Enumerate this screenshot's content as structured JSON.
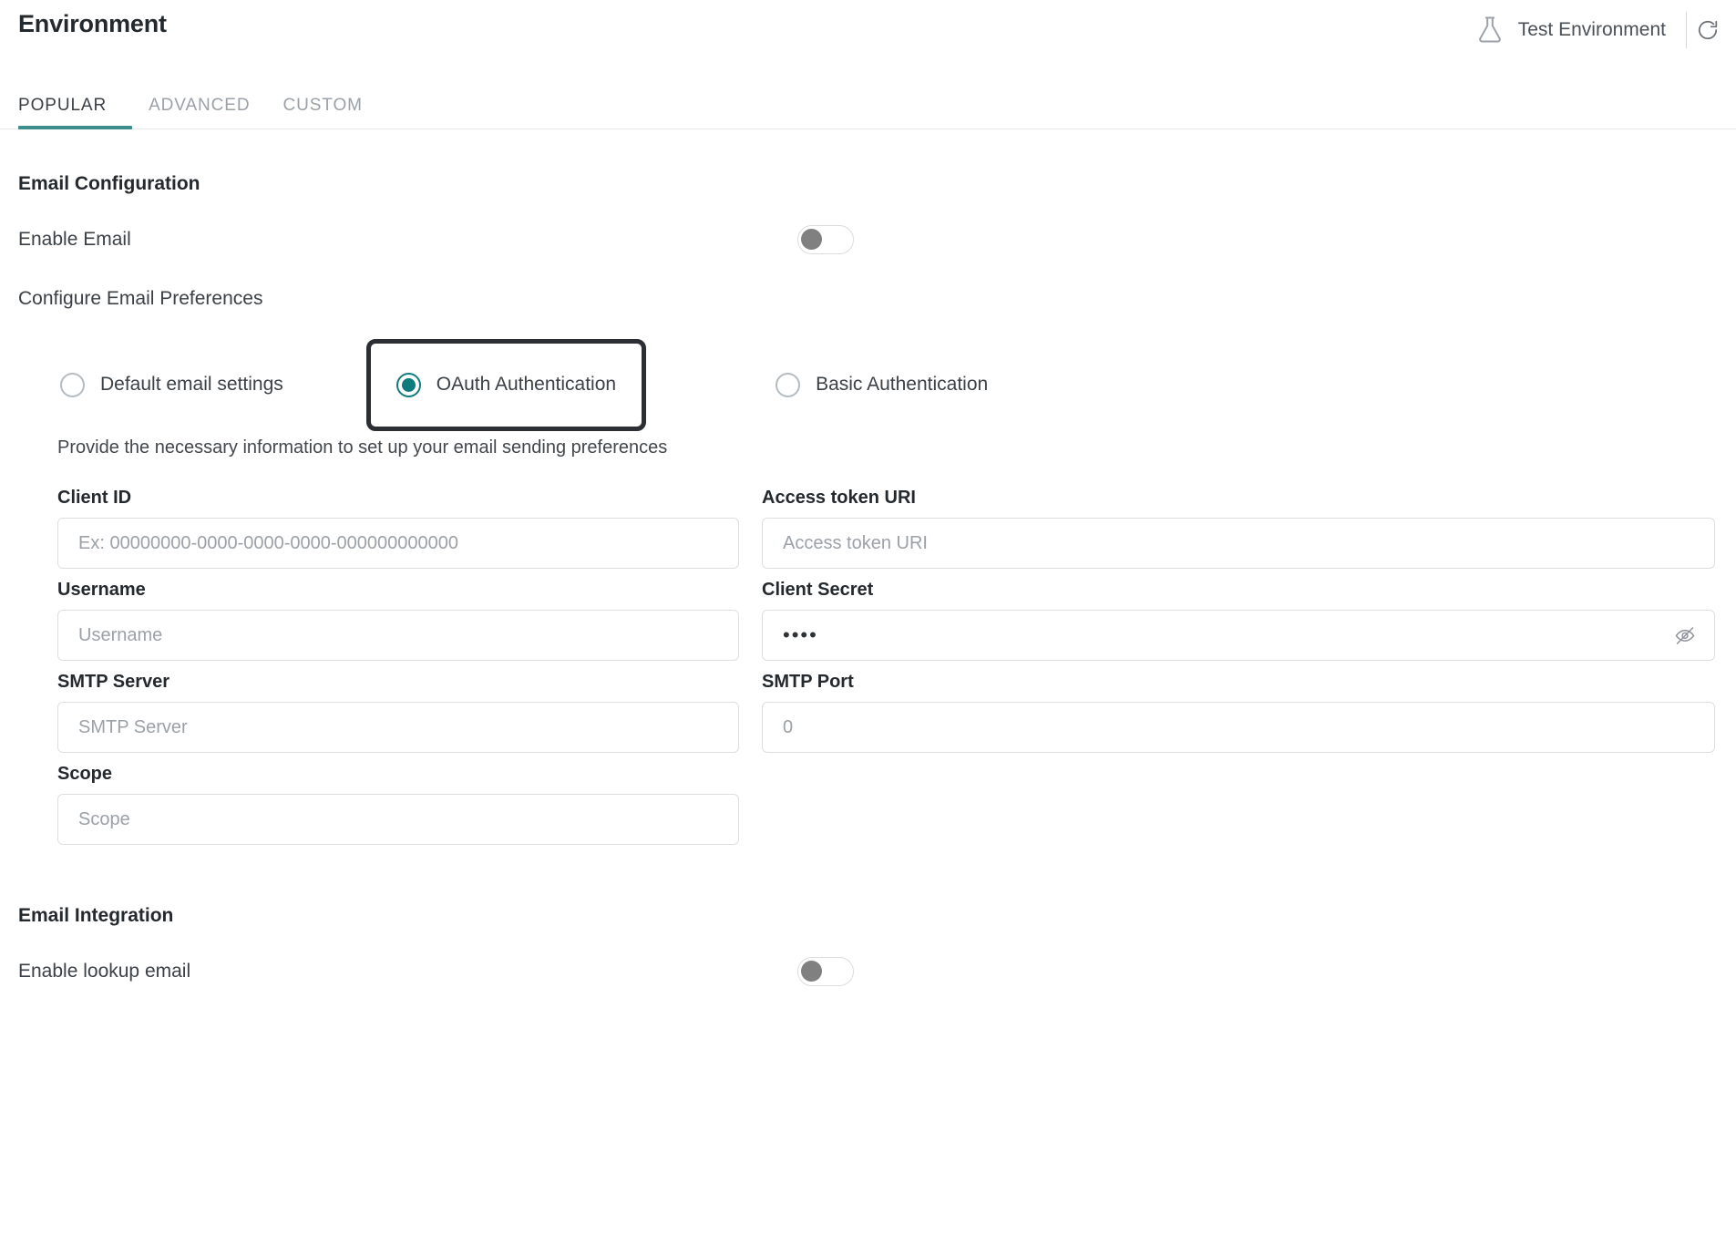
{
  "header": {
    "title": "Environment",
    "environment_label": "Test Environment",
    "flask_icon": "flask-icon",
    "refresh_icon": "refresh-icon"
  },
  "tabs": [
    {
      "label": "POPULAR",
      "active": true
    },
    {
      "label": "ADVANCED",
      "active": false
    },
    {
      "label": "CUSTOM",
      "active": false
    }
  ],
  "email_configuration": {
    "section_title": "Email Configuration",
    "enable_email": {
      "label": "Enable Email",
      "state": "off"
    },
    "configure_preferences_label": "Configure Email Preferences",
    "radio_options": [
      {
        "label": "Default email settings",
        "selected": false,
        "focused": false
      },
      {
        "label": "OAuth Authentication",
        "selected": true,
        "focused": true
      },
      {
        "label": "Basic Authentication",
        "selected": false,
        "focused": false
      }
    ],
    "helper_text": "Provide the necessary information to set up your email sending preferences",
    "fields": {
      "client_id": {
        "label": "Client ID",
        "placeholder": "Ex: 00000000-0000-0000-0000-000000000000",
        "value": ""
      },
      "access_token_uri": {
        "label": "Access token URI",
        "placeholder": "Access token URI",
        "value": ""
      },
      "username": {
        "label": "Username",
        "placeholder": "Username",
        "value": ""
      },
      "client_secret": {
        "label": "Client Secret",
        "placeholder": "",
        "value": "••••",
        "masked": true,
        "visibility_icon": "eye-slash-icon"
      },
      "smtp_server": {
        "label": "SMTP Server",
        "placeholder": "SMTP Server",
        "value": ""
      },
      "smtp_port": {
        "label": "SMTP Port",
        "placeholder": "0",
        "value": ""
      },
      "scope": {
        "label": "Scope",
        "placeholder": "Scope",
        "value": ""
      }
    }
  },
  "email_integration": {
    "section_title": "Email Integration",
    "enable_lookup_email": {
      "label": "Enable lookup email",
      "state": "off"
    }
  },
  "colors": {
    "accent_teal": "#3f8e8e",
    "radio_teal": "#0f7b7b",
    "focus_ring": "#2b2f33",
    "text_primary": "#24292e",
    "text_secondary": "#3b4146",
    "placeholder": "#9ba1a7",
    "border": "#dcdfe2"
  }
}
